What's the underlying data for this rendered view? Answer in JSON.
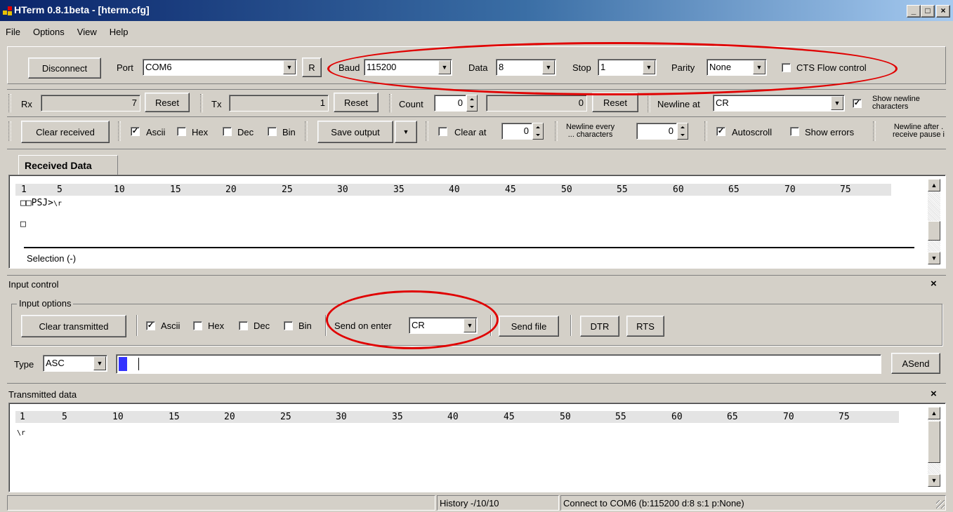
{
  "window": {
    "title": "HTerm 0.8.1beta - [hterm.cfg]",
    "min": "_",
    "max": "□",
    "close": "×"
  },
  "menu": [
    "File",
    "Options",
    "View",
    "Help"
  ],
  "connection": {
    "disconnect_label": "Disconnect",
    "port_label": "Port",
    "port_value": "COM6",
    "refresh_label": "R",
    "baud_label": "Baud",
    "baud_value": "115200",
    "data_label": "Data",
    "data_value": "8",
    "stop_label": "Stop",
    "stop_value": "1",
    "parity_label": "Parity",
    "parity_value": "None",
    "cts_label": "CTS Flow control",
    "cts_checked": false
  },
  "counters": {
    "rx_label": "Rx",
    "rx_value": "7",
    "rx_reset": "Reset",
    "tx_label": "Tx",
    "tx_value": "1",
    "tx_reset": "Reset",
    "count_label": "Count",
    "count_value": "0",
    "count_result": "0",
    "count_reset": "Reset",
    "newline_label": "Newline at",
    "newline_value": "CR",
    "show_newline_line1": "Show newline",
    "show_newline_line2": "characters",
    "show_newline_checked": true
  },
  "recv_toolbar": {
    "clear_received": "Clear received",
    "ascii": "Ascii",
    "hex": "Hex",
    "dec": "Dec",
    "bin": "Bin",
    "save_output": "Save output",
    "clear_at": "Clear at",
    "clear_at_value": "0",
    "newline_every_1": "Newline every",
    "newline_every_2": "... characters",
    "newline_every_value": "0",
    "autoscroll": "Autoscroll",
    "show_errors": "Show errors",
    "newline_after_1": "Newline after .",
    "newline_after_2": "receive pause i"
  },
  "received": {
    "tab": "Received Data",
    "ruler": [
      "1",
      "5",
      "10",
      "15",
      "20",
      "25",
      "30",
      "35",
      "40",
      "45",
      "50",
      "55",
      "60",
      "65",
      "70",
      "75"
    ],
    "line1": "□□PSJ>",
    "line1_escape": "\\r",
    "line2": "□",
    "selection": "Selection (-)"
  },
  "input_control": {
    "title": "Input control",
    "close": "×",
    "options_label": "Input options",
    "clear_transmitted": "Clear transmitted",
    "ascii": "Ascii",
    "hex": "Hex",
    "dec": "Dec",
    "bin": "Bin",
    "send_on_enter_label": "Send on enter",
    "send_on_enter_value": "CR",
    "send_file": "Send file",
    "dtr": "DTR",
    "rts": "RTS",
    "type_label": "Type",
    "type_value": "ASC",
    "asend": "ASend"
  },
  "transmitted": {
    "title": "Transmitted data",
    "close": "×",
    "ruler": [
      "1",
      "5",
      "10",
      "15",
      "20",
      "25",
      "30",
      "35",
      "40",
      "45",
      "50",
      "55",
      "60",
      "65",
      "70",
      "75"
    ],
    "line1": "\\r"
  },
  "statusbar": {
    "history": "History -/10/10",
    "status": "Connect to COM6 (b:115200 d:8 s:1 p:None)"
  },
  "colors": {
    "title_start": "#0a246a",
    "title_end": "#a6caf0",
    "highlight": "#e00000",
    "cursor": "#3333ff"
  }
}
